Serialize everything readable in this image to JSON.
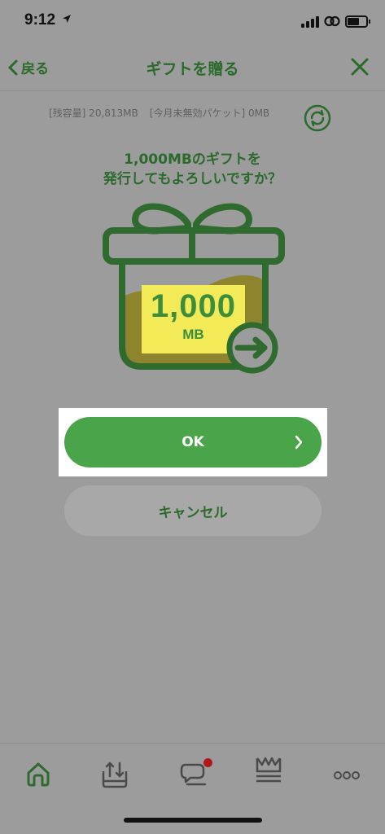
{
  "status_bar": {
    "time": "9:12"
  },
  "nav": {
    "back_label": "戻る",
    "title": "ギフトを贈る"
  },
  "balance": {
    "remaining": "[残容量] 20,813MB",
    "unused_packet": "[今月未無効パケット] 0MB"
  },
  "question": {
    "line1": "1,000MBのギフトを",
    "line2": "発行してもよろしいですか？"
  },
  "gift": {
    "amount": "1,000",
    "unit": "MB"
  },
  "buttons": {
    "ok_label": "OK",
    "cancel_label": "キャンセル"
  },
  "colors": {
    "brand_green": "#2c6a2c",
    "button_green": "#4aa54a",
    "highlight_yellow": "#f3ea57",
    "badge_red": "#b01818"
  },
  "tabs": [
    {
      "icon": "home-icon"
    },
    {
      "icon": "tray-upload-icon"
    },
    {
      "icon": "chat-bubble-icon",
      "badge": true
    },
    {
      "icon": "crown-icon"
    },
    {
      "icon": "more-icon"
    }
  ]
}
